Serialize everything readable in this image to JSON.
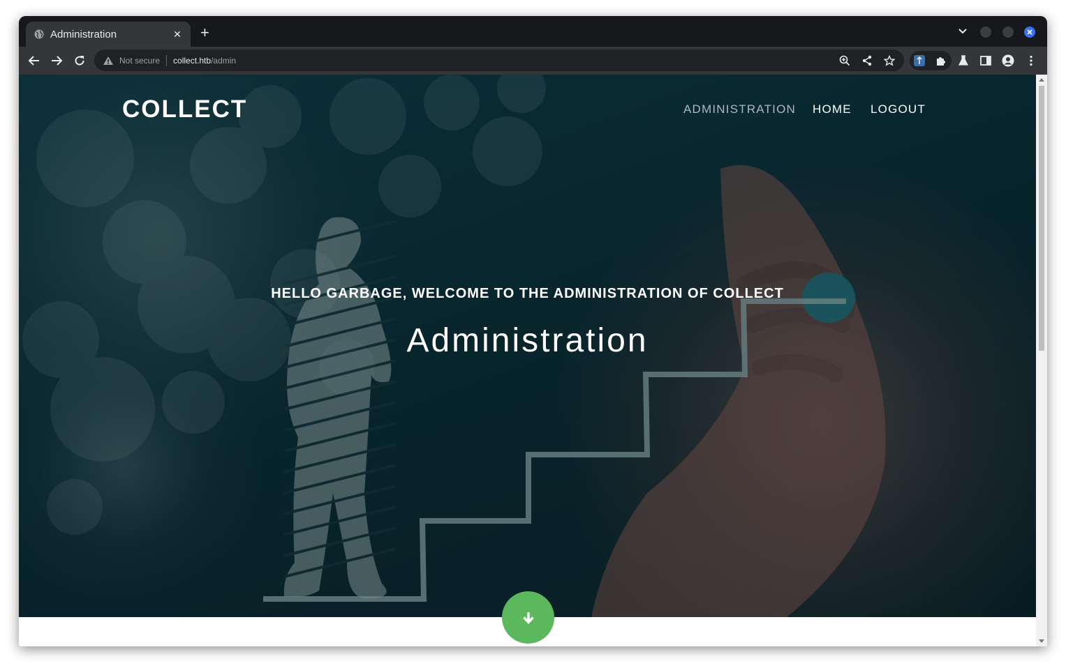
{
  "browser": {
    "tab": {
      "title": "Administration",
      "favicon": "globe-icon"
    },
    "address": {
      "security": "Not secure",
      "host": "collect.htb",
      "path": "/admin"
    },
    "theme": {
      "frame": "#17181c",
      "toolbar": "#35363a",
      "accent": "#3b6ff2"
    }
  },
  "site": {
    "brand": "COLLECT",
    "nav": [
      {
        "label": "ADMINISTRATION",
        "active": true
      },
      {
        "label": "HOME",
        "active": false
      },
      {
        "label": "LOGOUT",
        "active": false
      }
    ]
  },
  "hero": {
    "subtitle": "HELLO GARBAGE, WELCOME TO THE ADMINISTRATION OF COLLECT",
    "heading": "Administration",
    "scroll_button": {
      "icon": "arrow-down-icon",
      "color": "#5cb85c"
    }
  }
}
